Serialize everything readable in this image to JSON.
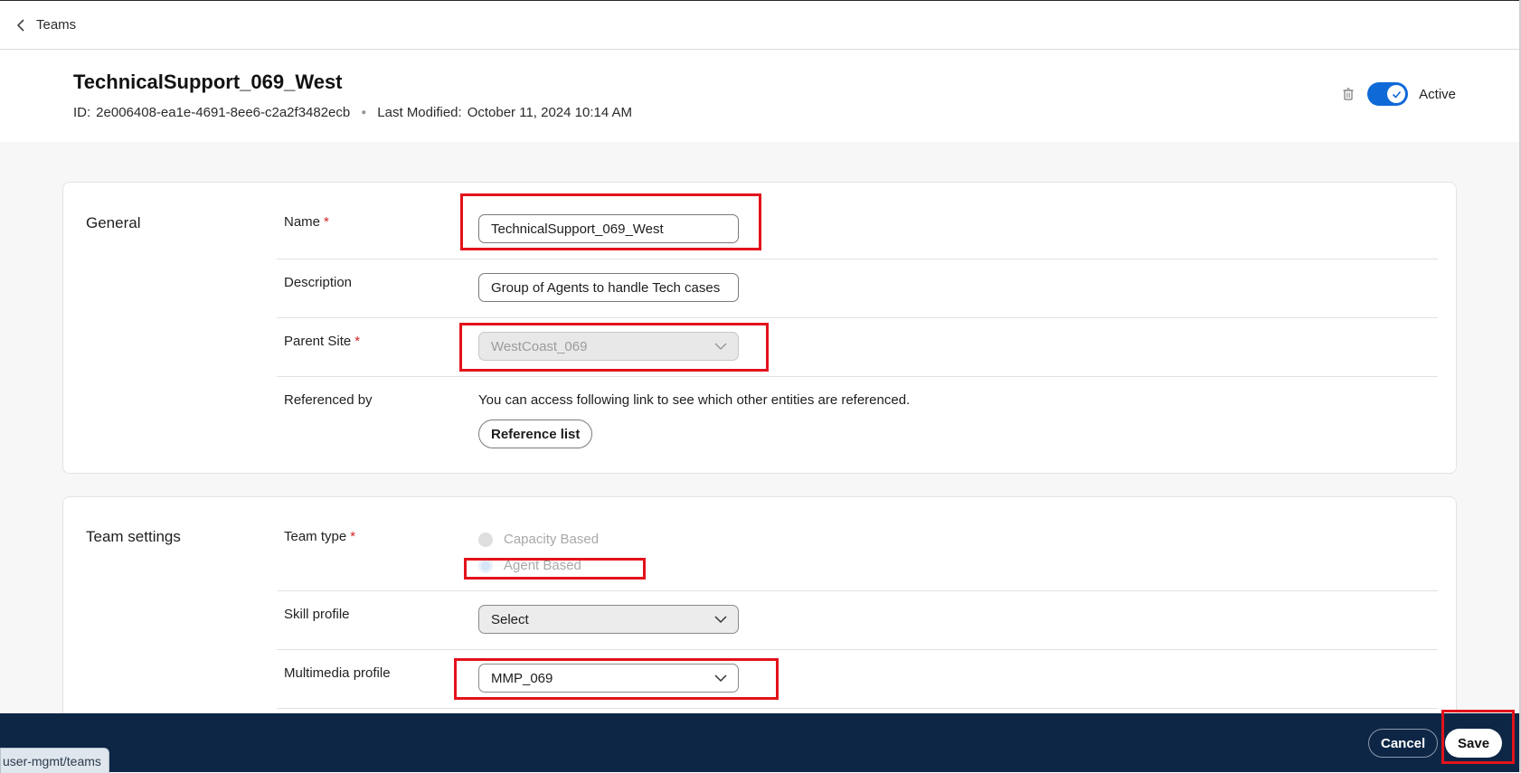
{
  "nav": {
    "back_label": "Teams"
  },
  "header": {
    "title": "TechnicalSupport_069_West",
    "id_label": "ID:",
    "id_value": "2e006408-ea1e-4691-8ee6-c2a2f3482ecb",
    "modified_label": "Last Modified:",
    "modified_value": "October 11, 2024 10:14 AM",
    "status_label": "Active",
    "status_on": true
  },
  "general": {
    "title": "General",
    "name_label": "Name",
    "name_value": "TechnicalSupport_069_West",
    "description_label": "Description",
    "description_value": "Group of Agents to handle Tech cases",
    "parent_site_label": "Parent Site",
    "parent_site_value": "WestCoast_069",
    "referenced_label": "Referenced by",
    "referenced_text": "You can access following link to see which other entities are referenced.",
    "reference_button": "Reference list",
    "required_mark": "*"
  },
  "team_settings": {
    "title": "Team settings",
    "team_type_label": "Team type",
    "team_type_options": [
      "Capacity Based",
      "Agent Based"
    ],
    "team_type_selected": "Agent Based",
    "skill_profile_label": "Skill profile",
    "skill_profile_value": "Select",
    "multimedia_label": "Multimedia profile",
    "multimedia_value": "MMP_069"
  },
  "footer": {
    "cancel_label": "Cancel",
    "save_label": "Save"
  },
  "status_bar": {
    "url": "user-mgmt/teams"
  },
  "colors": {
    "accent": "#0f6ad8",
    "footer_bg": "#0d2646",
    "annotation": "#e3121b",
    "required": "#d2232a"
  }
}
